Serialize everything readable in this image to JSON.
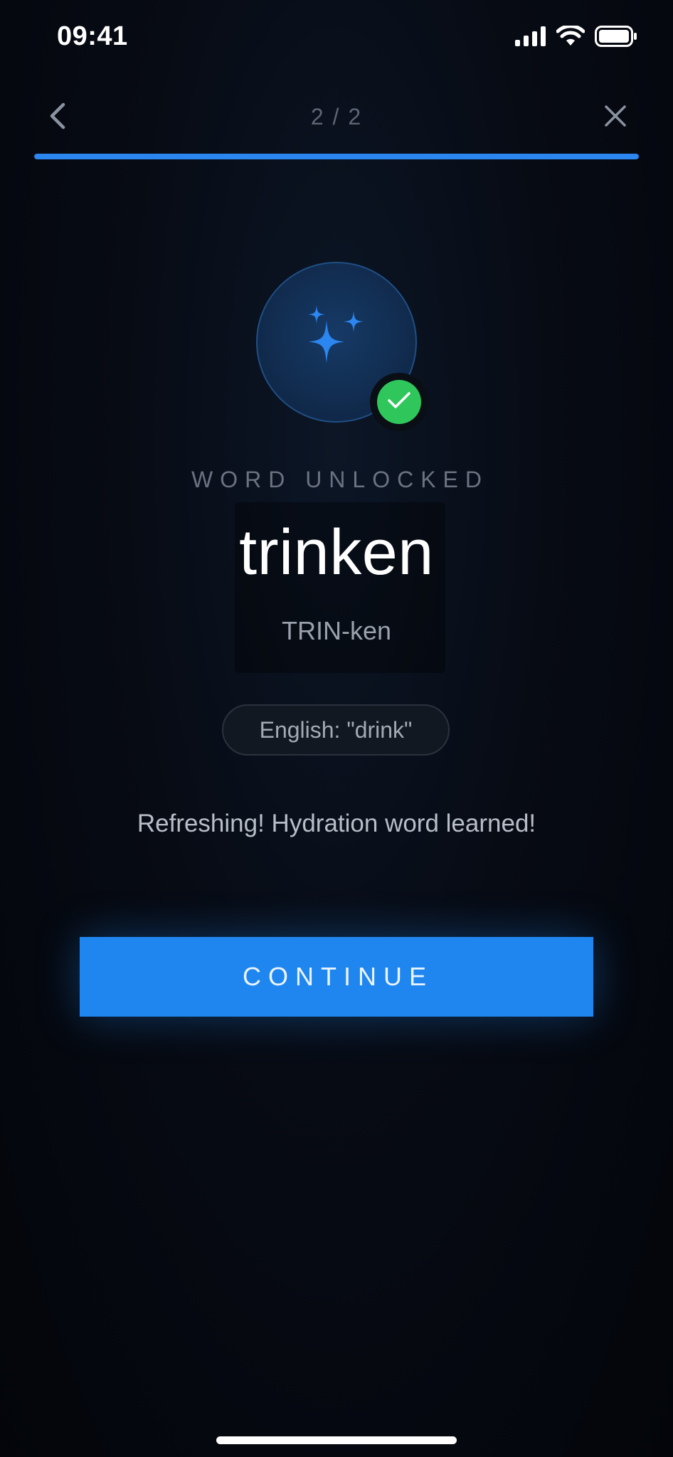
{
  "status_bar": {
    "time": "09:41",
    "icons": [
      "signal-icon",
      "wifi-icon",
      "battery-icon"
    ]
  },
  "nav": {
    "back_icon": "chevron-left-icon",
    "progress_label": "2 / 2",
    "close_icon": "close-icon",
    "progress_fraction": 1.0
  },
  "badge": {
    "icon": "sparkles-icon",
    "check_icon": "checkmark-icon"
  },
  "content": {
    "unlock_label": "WORD UNLOCKED",
    "word": "trinken",
    "pronunciation": "TRIN-ken",
    "translation": "English: \"drink\"",
    "message": "Refreshing! Hydration word learned!"
  },
  "actions": {
    "continue_label": "CONTINUE"
  },
  "colors": {
    "accent": "#1f86f0",
    "success": "#2fc75c",
    "background": "#070b14"
  }
}
